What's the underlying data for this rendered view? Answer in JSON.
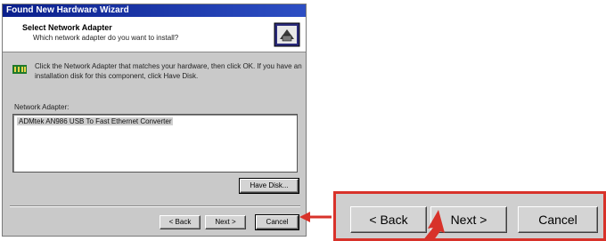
{
  "window": {
    "title": "Found New Hardware Wizard"
  },
  "header": {
    "title": "Select Network Adapter",
    "subtitle": "Which network adapter do you want to install?"
  },
  "instructions": "Click the Network Adapter that matches your hardware, then click OK. If you have an installation disk for this component, click Have Disk.",
  "adapter_list": {
    "label": "Network Adapter:",
    "items": [
      "ADMtek AN986 USB To Fast Ethernet Converter"
    ],
    "selected_index": 0
  },
  "buttons": {
    "have_disk": "Have Disk...",
    "back": "< Back",
    "next": "Next >",
    "cancel": "Cancel"
  },
  "zoom_callout": {
    "back": "< Back",
    "next": "Next >",
    "cancel": "Cancel"
  },
  "colors": {
    "annotation": "#d8322a",
    "titlebar": "#0a1f8c",
    "dialog_face": "#c9c9c9"
  },
  "icons": [
    "wizard-header-icon",
    "network-hardware-icon",
    "callout-arrow-icon",
    "pointer-arrow-icon"
  ]
}
